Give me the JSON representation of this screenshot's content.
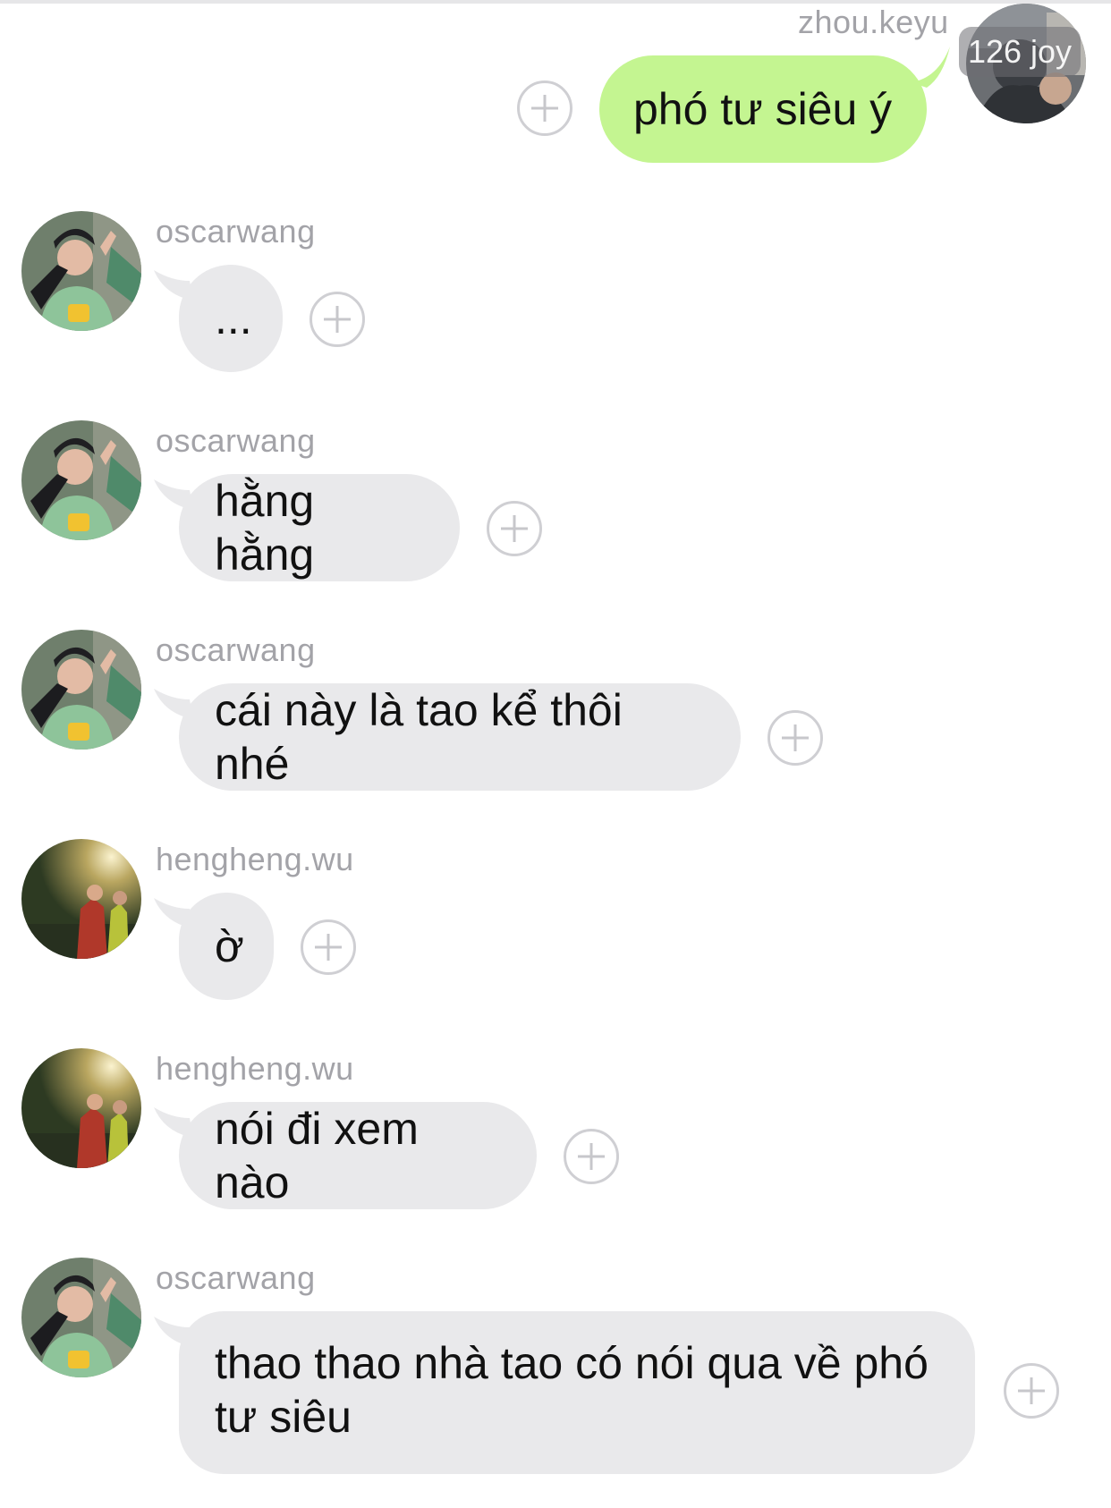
{
  "outgoing": {
    "username": "zhou.keyu",
    "badge": "126 joy",
    "text": "phó tư siêu ý",
    "color": "#c4f591"
  },
  "messages": [
    {
      "username": "oscarwang",
      "text": "..."
    },
    {
      "username": "oscarwang",
      "text": "hằng hằng"
    },
    {
      "username": "oscarwang",
      "text": "cái này là tao kể thôi nhé"
    },
    {
      "username": "hengheng.wu",
      "text": "ờ"
    },
    {
      "username": "hengheng.wu",
      "text": "nói đi xem nào"
    },
    {
      "username": "oscarwang",
      "text": "thao thao nhà tao có nói qua về phó tư siêu"
    }
  ],
  "colors": {
    "incoming_bubble": "#e9e9eb",
    "username": "#a3a3a8",
    "plus_icon": "#c7c7cb"
  },
  "icons": {
    "add": "plus-circle-icon"
  }
}
